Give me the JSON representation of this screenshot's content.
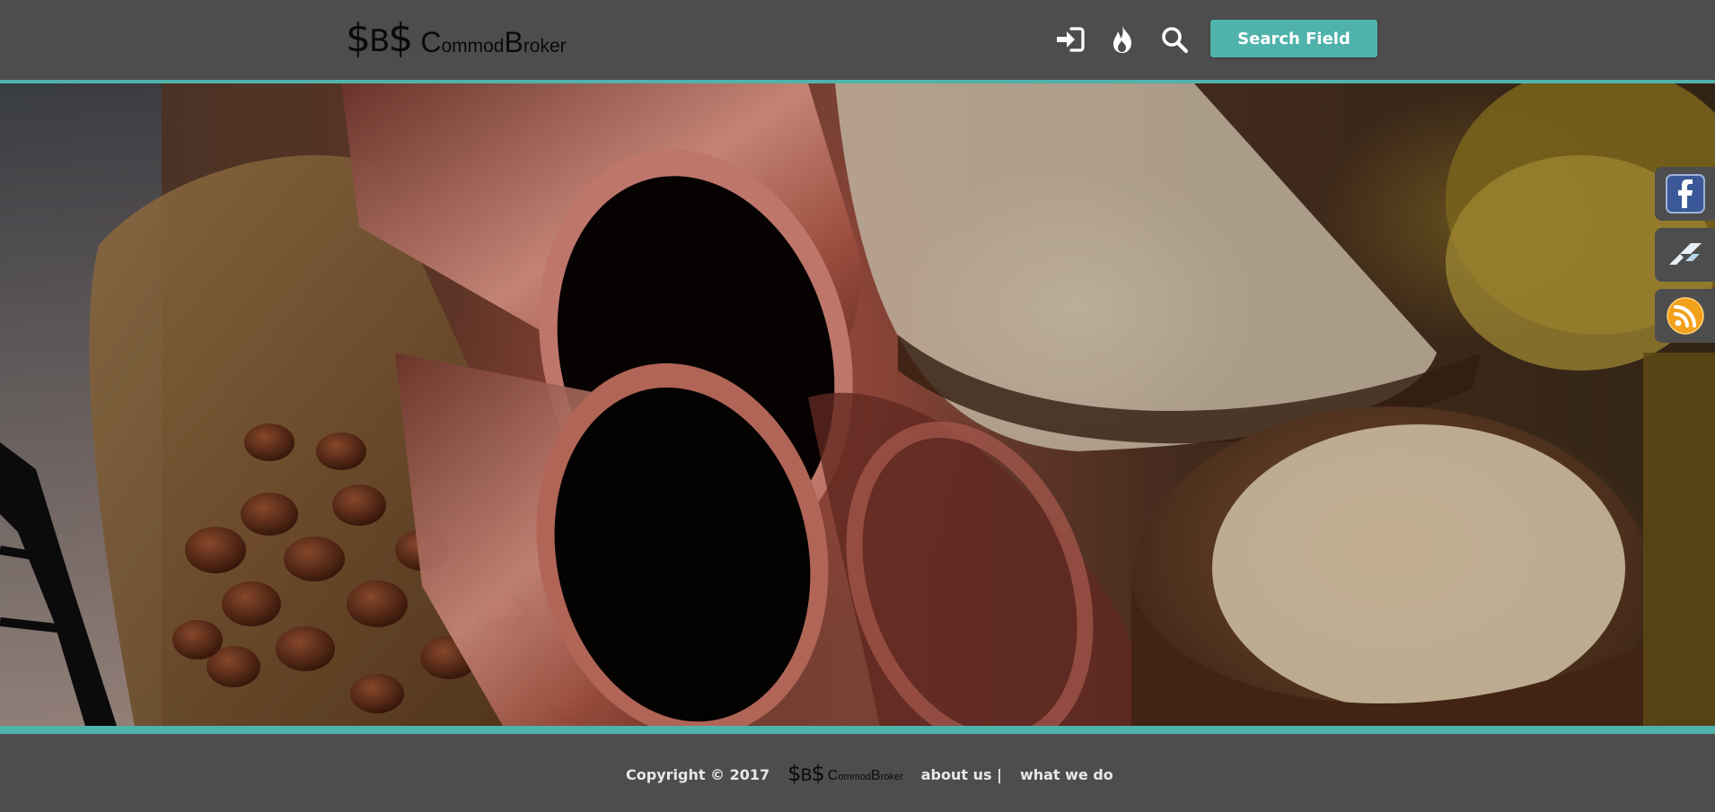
{
  "header": {
    "logo": {
      "mark_s1": "$",
      "mark_b": "B",
      "mark_s2": "$",
      "word_c": "C",
      "word_1": "ommod",
      "word_b": "B",
      "word_2": "roker"
    },
    "icons": [
      "sign-in-icon",
      "fire-icon",
      "search-icon"
    ],
    "search_button_label": "Search Field"
  },
  "hero": {
    "image_subjects": [
      "coffee-beans",
      "copper-pipes",
      "rice",
      "oat-flakes",
      "gold-coins"
    ]
  },
  "social": {
    "items": [
      {
        "icon": "facebook-icon"
      },
      {
        "icon": "network-icon"
      },
      {
        "icon": "rss-icon"
      }
    ]
  },
  "footer": {
    "copyright": "Copyright © 2017",
    "logo": {
      "mark_s1": "$",
      "mark_b": "B",
      "mark_s2": "$",
      "word_c": "C",
      "word_1": "ommod",
      "word_b": "B",
      "word_2": "roker"
    },
    "links": {
      "about": "about us |",
      "what_we_do": "what we do"
    }
  },
  "colors": {
    "background": "#4d4d4d",
    "accent": "#4fb3ac",
    "footer_text": "#e8e8e8"
  }
}
